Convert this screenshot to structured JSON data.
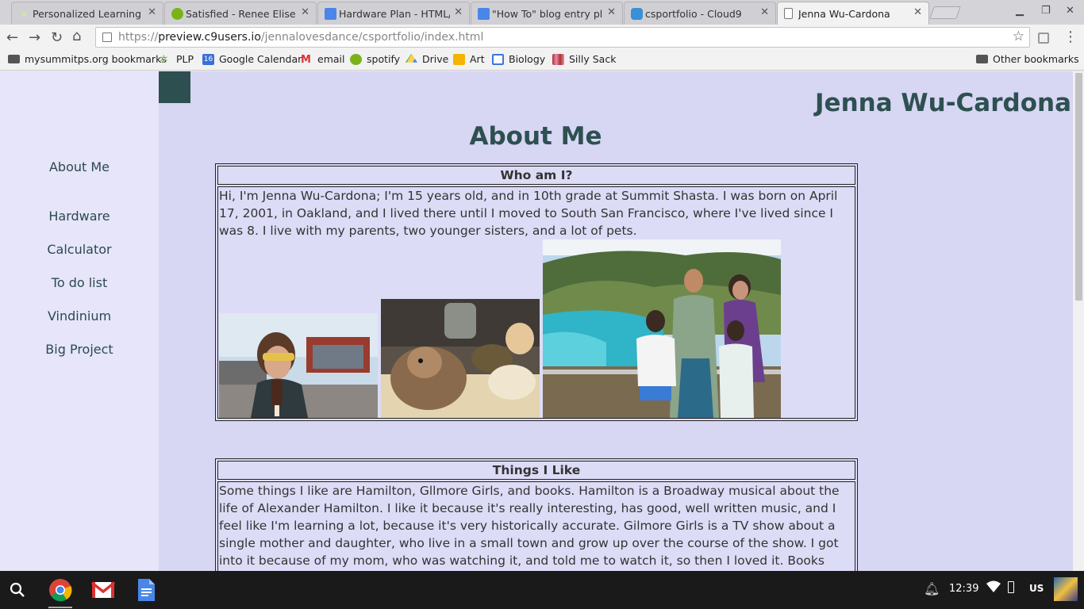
{
  "browser": {
    "tabs": [
      {
        "title": "Personalized Learning P",
        "favicon": "plp-icon",
        "active": false
      },
      {
        "title": "Satisfied - Renee Elise Go",
        "favicon": "spotify-icon",
        "active": false
      },
      {
        "title": "Hardware Plan - HTML/C",
        "favicon": "docs-icon",
        "active": false
      },
      {
        "title": "\"How To\" blog entry plan",
        "favicon": "docs-icon",
        "active": false
      },
      {
        "title": "csportfolio - Cloud9",
        "favicon": "cloud9-icon",
        "active": false
      },
      {
        "title": "Jenna Wu-Cardona",
        "favicon": "page-icon",
        "active": true
      }
    ],
    "url": {
      "scheme": "https://",
      "host": "preview.c9users.io",
      "path": "/jennalovesdance/csportfolio/index.html"
    },
    "bookmarks": [
      {
        "label": "mysummitps.org bookmarks",
        "icon": "folder-icon"
      },
      {
        "label": "PLP",
        "icon": "plp-icon"
      },
      {
        "label": "Google Calendar",
        "icon": "calendar-icon"
      },
      {
        "label": "email",
        "icon": "gmail-icon"
      },
      {
        "label": "spotify",
        "icon": "spotify-icon"
      },
      {
        "label": "Drive",
        "icon": "drive-icon"
      },
      {
        "label": "Art",
        "icon": "slides-icon"
      },
      {
        "label": "Biology",
        "icon": "classroom-icon"
      },
      {
        "label": "Silly Sack",
        "icon": "image-icon"
      }
    ],
    "other_bookmarks": "Other bookmarks",
    "calendar_day": "16"
  },
  "page": {
    "site_title": "Jenna Wu-Cardona",
    "heading": "About Me",
    "nav": [
      "About Me",
      "Hardware",
      "Calculator",
      "To do list",
      "Vindinium",
      "Big Project"
    ],
    "sections": [
      {
        "title": "Who am I?",
        "text": "Hi, I'm Jenna Wu-Cardona; I'm 15 years old, and in 10th grade at Summit Shasta. I was born on April 17, 2001, in Oakland, and I lived there until I moved to South San Francisco, where I've lived since I was 8. I live with my parents, two younger sisters, and a lot of pets."
      },
      {
        "title": "Things I Like",
        "text": "Some things I like are Hamilton, Gllmore Girls, and books. Hamilton is a Broadway musical about the life of Alexander Hamilton. I like it because it's really interesting, has good, well written music, and I feel like I'm learning a lot, because it's very historically accurate. Gilmore Girls is a TV show about a single mother and daughter, who live in a small town and grow up over the course of the show. I got into it because of my mom, who was watching it, and told me to watch it, so then I loved it. Books have always been a large part"
      }
    ],
    "colors": {
      "background": "#d7d6f3",
      "sidebar": "#e6e5fa",
      "accent": "#2d4f4f"
    }
  },
  "shelf": {
    "apps": [
      "search-icon",
      "chrome-icon",
      "gmail-icon",
      "docs-icon"
    ],
    "time": "12:39",
    "locale": "US"
  }
}
